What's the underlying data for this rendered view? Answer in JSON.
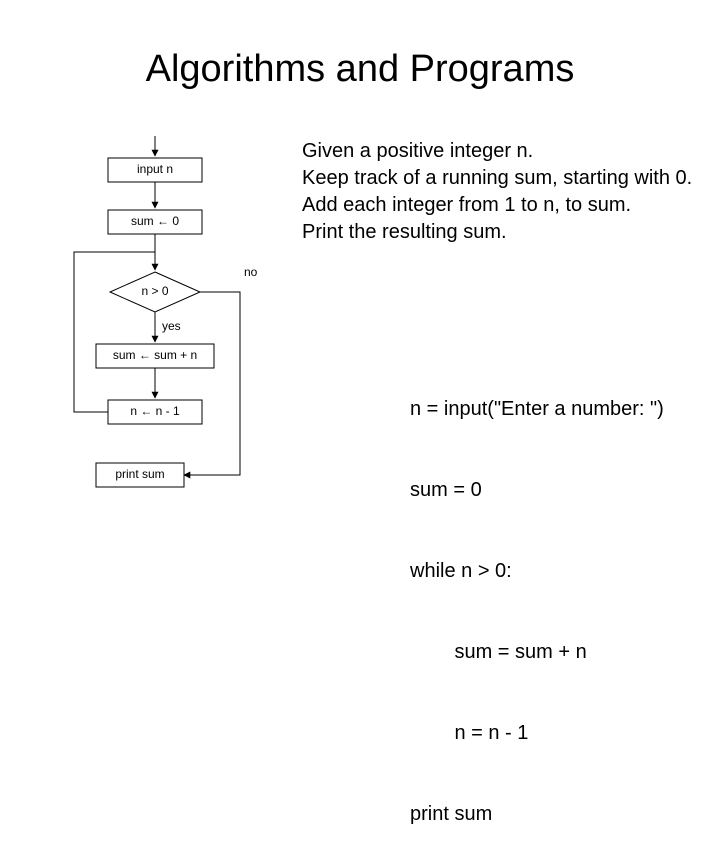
{
  "title": "Algorithms and Programs",
  "description": {
    "line1": "Given a positive integer n.",
    "line2": "Keep track of a running sum, starting with 0.",
    "line3": "Add each integer from 1 to n, to sum.",
    "line4": "Print the resulting sum."
  },
  "flowchart": {
    "nodes": {
      "input": "input n",
      "init": "sum ← 0",
      "cond": "n > 0",
      "add": "sum ← sum + n",
      "dec": "n ← n - 1",
      "print": "print sum"
    },
    "edges": {
      "yes": "yes",
      "no": "no"
    }
  },
  "code": {
    "l1": "n = input(\"Enter a number: \")",
    "l2": "sum = 0",
    "l3": "while n > 0:",
    "l4": "        sum = sum + n",
    "l5": "        n = n - 1",
    "l6": "print sum"
  }
}
